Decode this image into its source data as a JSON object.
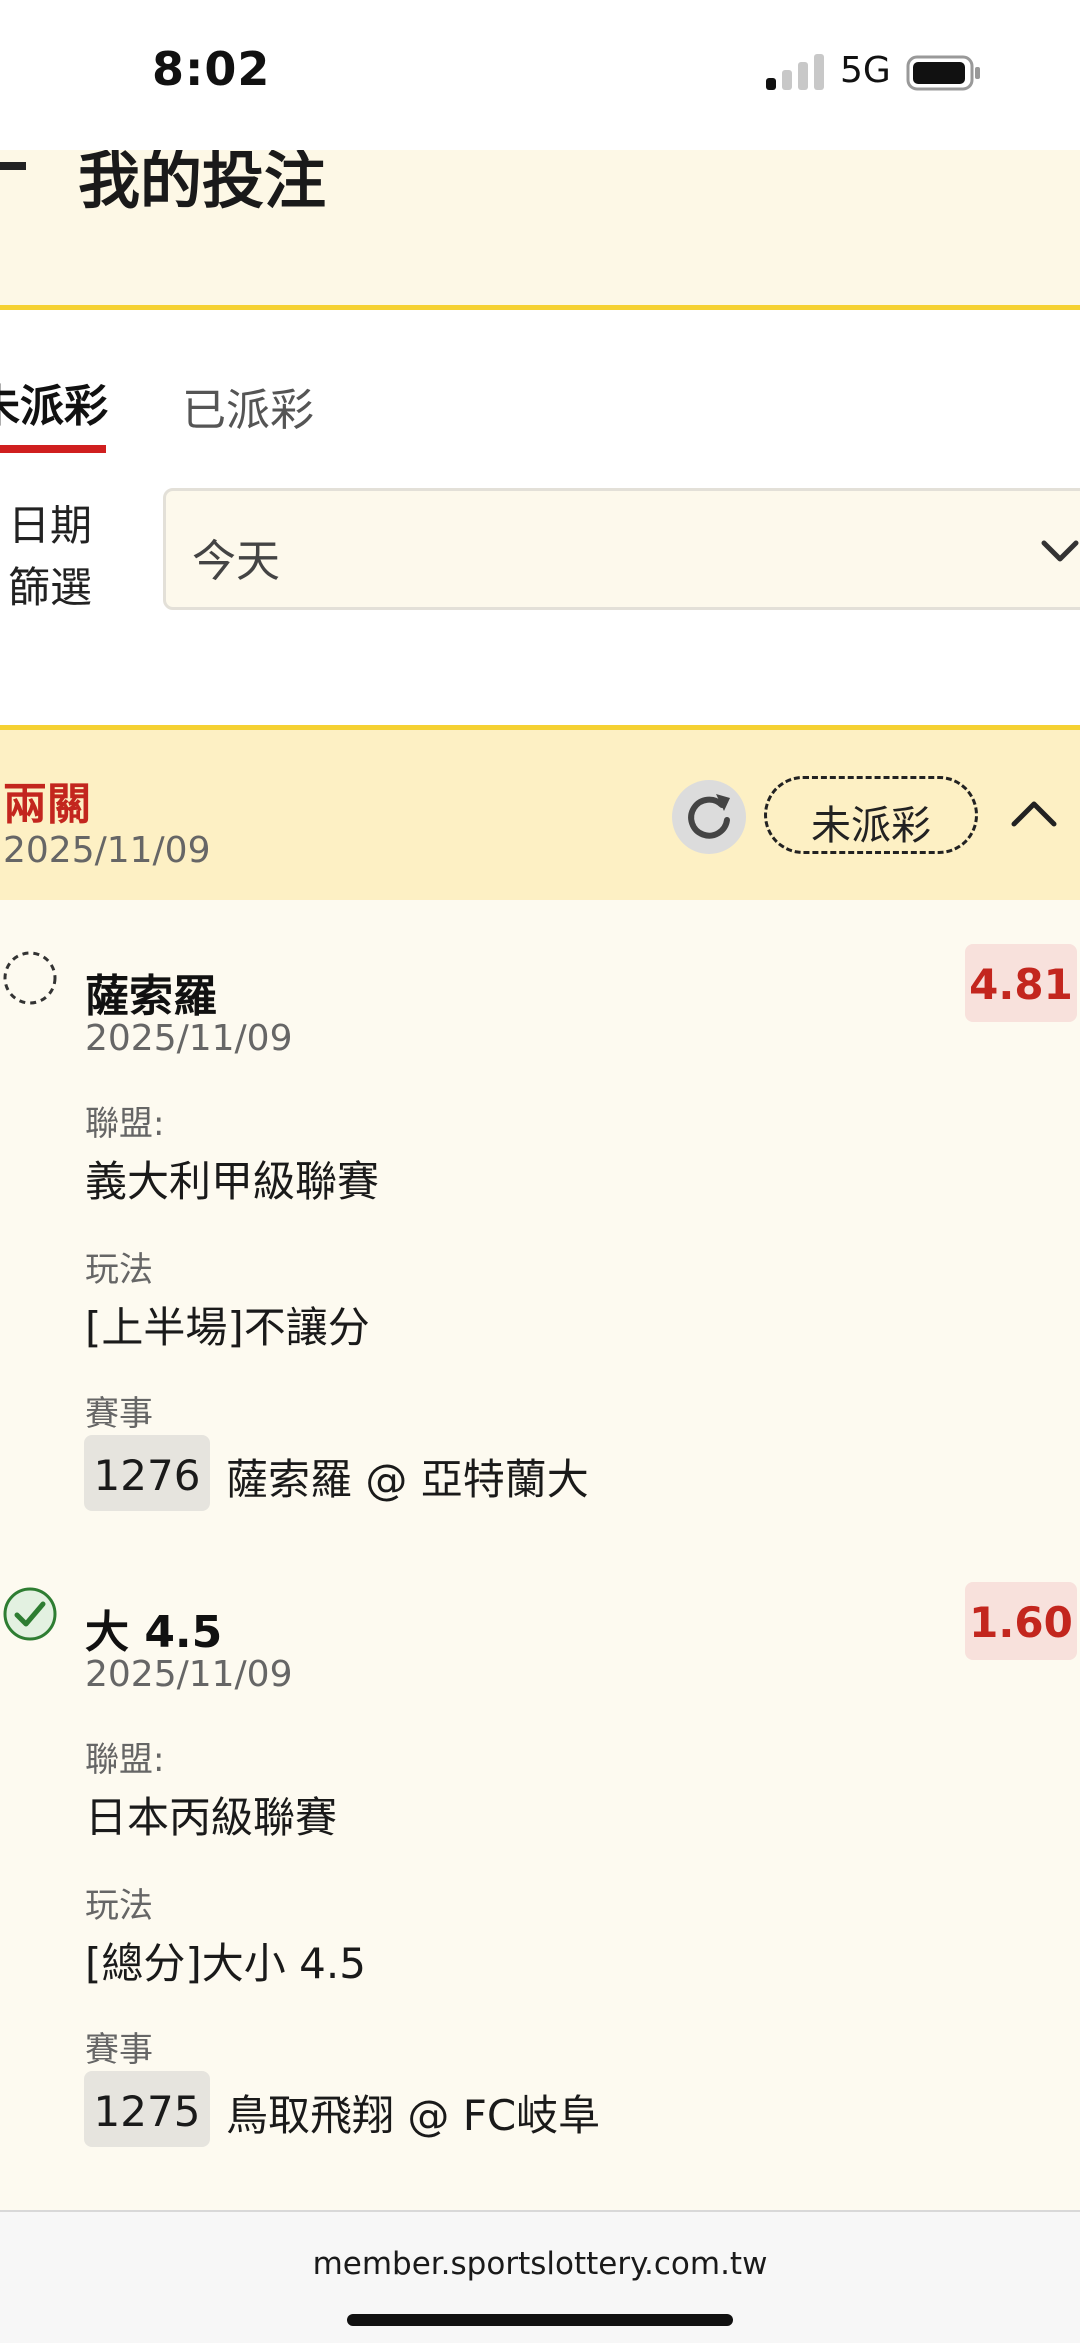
{
  "status_bar": {
    "time": "8:02",
    "network": "5G",
    "signal_bars": 1
  },
  "header": {
    "title": "我的投注"
  },
  "tabs": [
    {
      "label": "未派彩",
      "active": true
    },
    {
      "label": "已派彩",
      "active": false
    }
  ],
  "date_filter": {
    "label": "日期\n篩選",
    "value": "今天"
  },
  "bet_group": {
    "type": "兩關",
    "date": "2025/11/09",
    "status": "未派彩",
    "legs": [
      {
        "selection": "薩索羅",
        "date": "2025/11/09",
        "odds": "4.81",
        "result_icon": "pending-dashed-circle-icon",
        "league_label": "聯盟:",
        "league": "義大利甲級聯賽",
        "market_label": "玩法",
        "market": "[上半場]不讓分",
        "event_label": "賽事",
        "match_no": "1276",
        "match": "薩索羅 @ 亞特蘭大"
      },
      {
        "selection": "大 4.5",
        "date": "2025/11/09",
        "odds": "1.60",
        "result_icon": "check-circle-icon",
        "league_label": "聯盟:",
        "league": "日本丙級聯賽",
        "market_label": "玩法",
        "market": "[總分]大小 4.5",
        "event_label": "賽事",
        "match_no": "1275",
        "match": "鳥取飛翔 @ FC岐阜"
      }
    ]
  },
  "browser": {
    "url": "member.sportslottery.com.tw"
  },
  "colors": {
    "accent_red": "#c3261e",
    "accent_yellow": "#f5d132",
    "success_green": "#2e8b3a"
  }
}
